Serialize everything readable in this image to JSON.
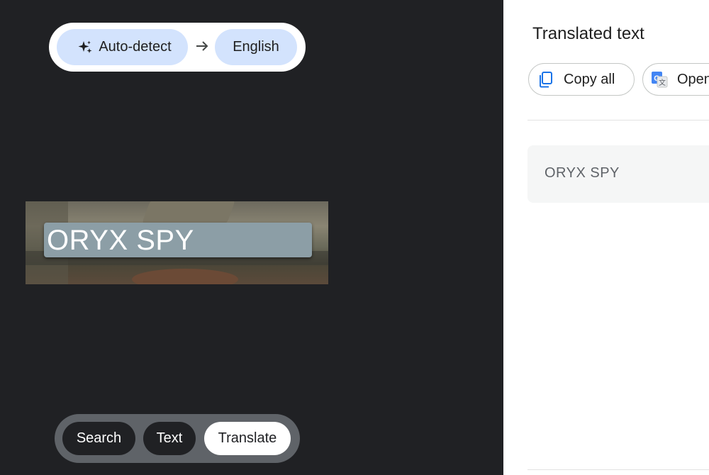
{
  "language_bar": {
    "source_label": "Auto-detect",
    "target_label": "English",
    "source_icon": "sparkle-icon",
    "separator_icon": "arrow-right-icon"
  },
  "image": {
    "detected_text": "ORYX SPY"
  },
  "modes": {
    "search_label": "Search",
    "text_label": "Text",
    "translate_label": "Translate",
    "active": "Translate"
  },
  "panel": {
    "title": "Translated text",
    "copy_label": "Copy all",
    "copy_icon": "copy-icon",
    "open_label": "Open",
    "open_icon": "google-translate-icon",
    "translated_text": "ORYX SPY"
  },
  "colors": {
    "chip_blue": "#d3e3fd",
    "dark_bg": "#202124",
    "accent_blue": "#1a73e8"
  }
}
